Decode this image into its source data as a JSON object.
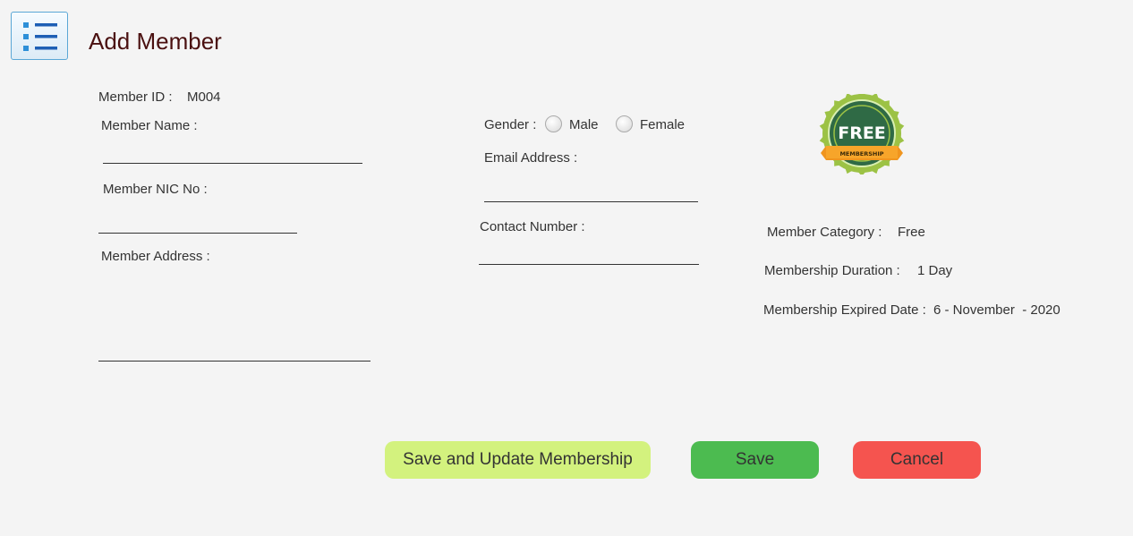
{
  "header": {
    "title": "Add Member",
    "menu_icon": "list-icon"
  },
  "form": {
    "member_id_label": "Member ID :",
    "member_id_value": "M004",
    "member_name_label": "Member Name :",
    "member_name_value": "",
    "nic_label": "Member NIC No :",
    "nic_value": "",
    "address_label": "Member Address :",
    "address_value": "",
    "gender_label": "Gender :",
    "gender_options": [
      "Male",
      "Female"
    ],
    "email_label": "Email Address :",
    "email_value": "",
    "contact_label": "Contact Number :",
    "contact_value": ""
  },
  "membership": {
    "badge_text": "FREE",
    "badge_ribbon": "MEMBERSHIP",
    "category_label": "Member Category :",
    "category_value": "Free",
    "duration_label": "Membership Duration :",
    "duration_value": "1 Day",
    "expiry_label": "Membership Expired Date :",
    "expiry_value": "6 - November  - 2020"
  },
  "actions": {
    "save_update_label": "Save and Update Membership",
    "save_label": "Save",
    "cancel_label": "Cancel"
  },
  "colors": {
    "title": "#4a1010",
    "save_update_bg": "#d3f27e",
    "save_bg": "#4cbb50",
    "cancel_bg": "#f5544f"
  }
}
